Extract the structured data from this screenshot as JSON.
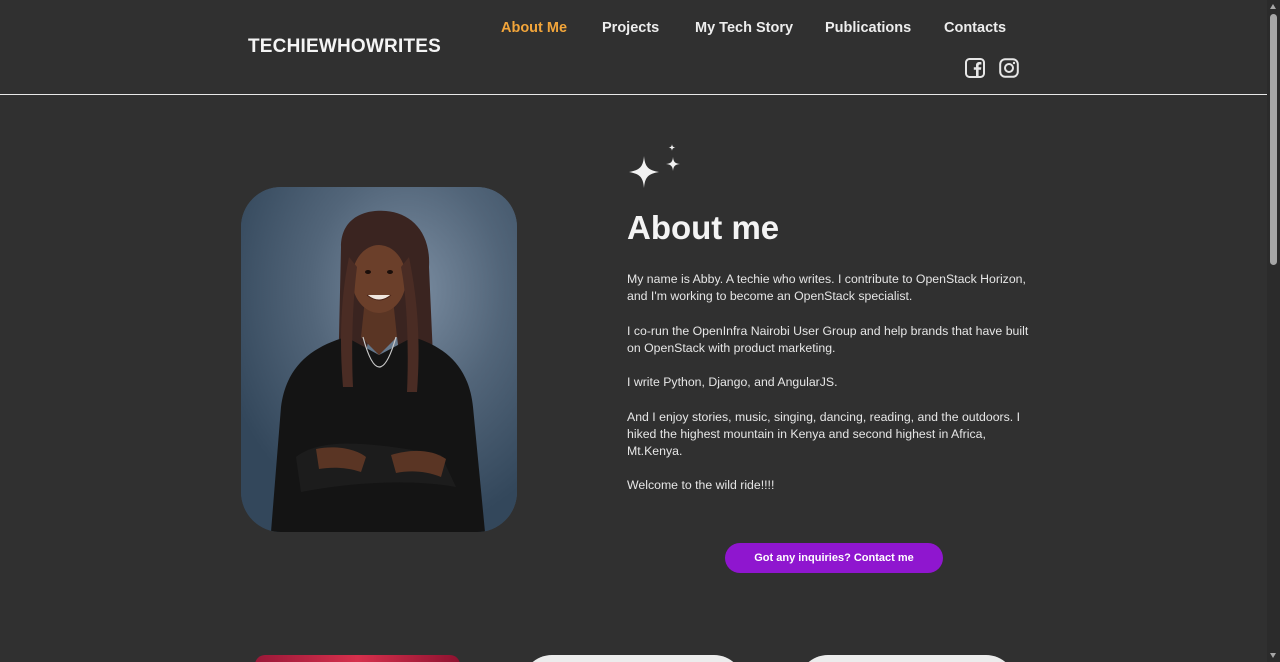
{
  "header": {
    "logo": "TECHIEWHOWRITES",
    "nav": [
      {
        "label": "About Me",
        "active": true
      },
      {
        "label": "Projects",
        "active": false
      },
      {
        "label": "My Tech Story",
        "active": false
      },
      {
        "label": "Publications",
        "active": false
      },
      {
        "label": "Contacts",
        "active": false
      }
    ],
    "social": [
      {
        "icon": "facebook-icon"
      },
      {
        "icon": "instagram-icon"
      }
    ]
  },
  "about": {
    "title": "About me",
    "paragraphs": [
      "My name is Abby. A techie who writes. I contribute to OpenStack Horizon, and I'm working to become an OpenStack specialist.",
      "I co-run the OpenInfra Nairobi User Group and help brands that have built on OpenStack with product marketing.",
      "I write Python, Django, and AngularJS.",
      "And I enjoy stories, music, singing, dancing, reading, and the outdoors. I hiked the highest mountain in Kenya and second highest in Africa, Mt.Kenya.",
      "Welcome to the wild ride!!!!"
    ],
    "button_label": "Got any inquiries? Contact me"
  },
  "colors": {
    "background": "#303030",
    "nav_active": "#f2a53a",
    "button": "#8f16cf"
  }
}
